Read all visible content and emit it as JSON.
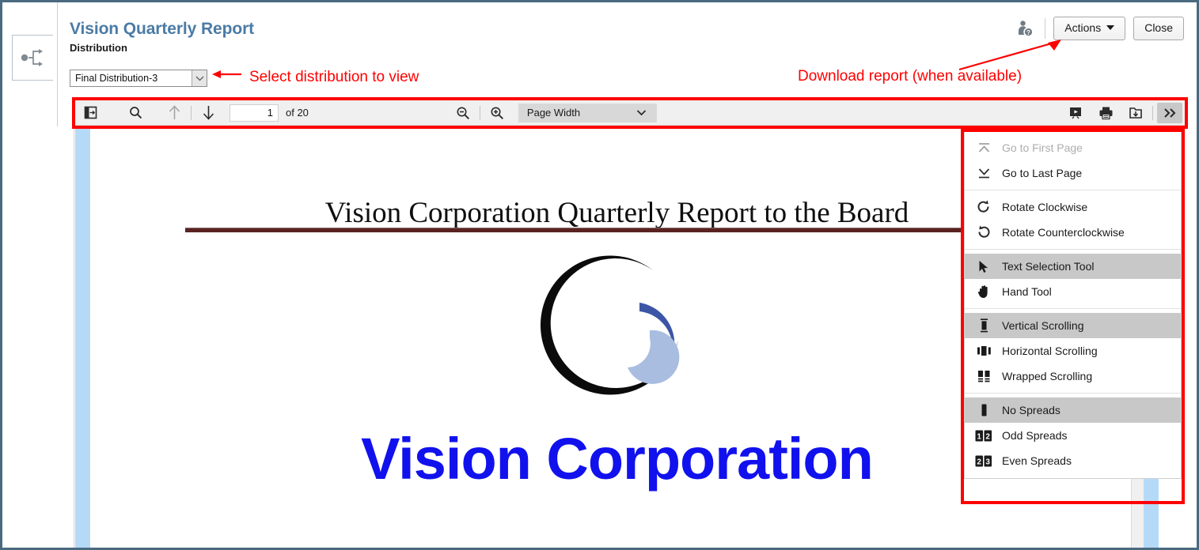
{
  "header": {
    "title": "Vision Quarterly Report",
    "subtitle": "Distribution",
    "help_icon": "person-help-icon",
    "actions_label": "Actions",
    "close_label": "Close"
  },
  "distribution": {
    "selected": "Final Distribution-3",
    "annotation": "Select distribution to view"
  },
  "annotations": {
    "download": "Download report (when available)",
    "arrow_color": "#ff0000",
    "highlight_color": "#ff0000"
  },
  "pdf_toolbar": {
    "sidebar_toggle_icon": "sidebar-toggle-icon",
    "find_icon": "search-icon",
    "previous_icon": "arrow-up-icon",
    "next_icon": "arrow-down-icon",
    "page_number": "1",
    "page_total": "of 20",
    "zoom_out_icon": "zoom-out-icon",
    "zoom_in_icon": "zoom-in-icon",
    "scale_value": "Page Width",
    "presentation_icon": "presentation-mode-icon",
    "print_icon": "print-icon",
    "save_icon": "save-download-icon",
    "tools_icon": "double-chevron-right-icon"
  },
  "tools_menu": {
    "groups": [
      {
        "items": [
          {
            "label": "Go to First Page",
            "icon": "go-to-first-page-icon",
            "state": "disabled"
          },
          {
            "label": "Go to Last Page",
            "icon": "go-to-last-page-icon",
            "state": "normal"
          }
        ]
      },
      {
        "items": [
          {
            "label": "Rotate Clockwise",
            "icon": "rotate-clockwise-icon",
            "state": "normal"
          },
          {
            "label": "Rotate Counterclockwise",
            "icon": "rotate-counterclockwise-icon",
            "state": "normal"
          }
        ]
      },
      {
        "items": [
          {
            "label": "Text Selection Tool",
            "icon": "cursor-arrow-icon",
            "state": "selected"
          },
          {
            "label": "Hand Tool",
            "icon": "hand-icon",
            "state": "normal"
          }
        ]
      },
      {
        "items": [
          {
            "label": "Vertical Scrolling",
            "icon": "vertical-scrolling-icon",
            "state": "selected"
          },
          {
            "label": "Horizontal Scrolling",
            "icon": "horizontal-scrolling-icon",
            "state": "normal"
          },
          {
            "label": "Wrapped Scrolling",
            "icon": "wrapped-scrolling-icon",
            "state": "normal"
          }
        ]
      },
      {
        "items": [
          {
            "label": "No Spreads",
            "icon": "no-spreads-icon",
            "state": "selected"
          },
          {
            "label": "Odd Spreads",
            "icon": "odd-spreads-icon",
            "state": "normal"
          },
          {
            "label": "Even Spreads",
            "icon": "even-spreads-icon",
            "state": "normal"
          }
        ]
      }
    ]
  },
  "document": {
    "title": "Vision Corporation Quarterly Report to the Board",
    "wordmark": "Vision Corporation",
    "logo_name": "vision-corporation-crescent-logo",
    "rule_color": "#5a2222",
    "wordmark_color": "#1111ee"
  },
  "left_rail": {
    "tab_icon": "workflow-branch-icon"
  }
}
